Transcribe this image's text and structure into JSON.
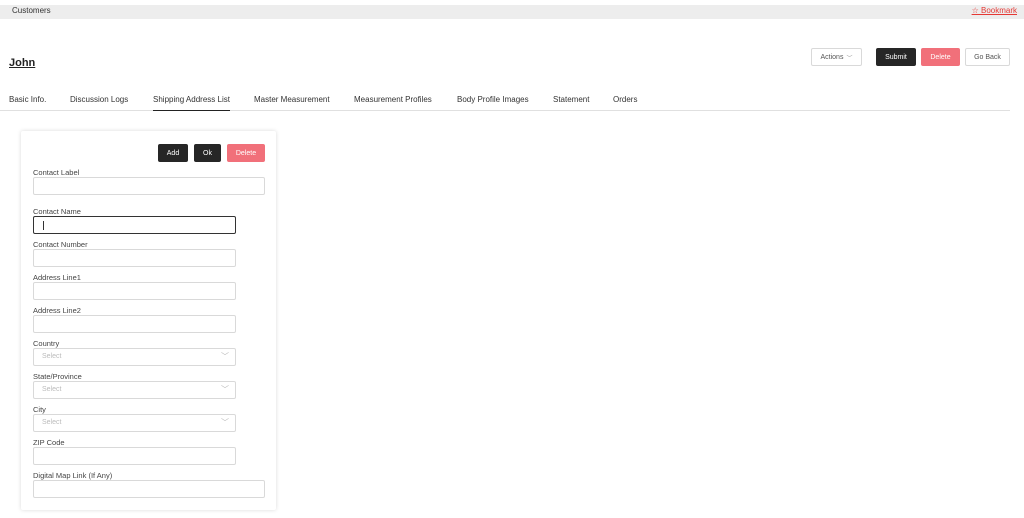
{
  "breadcrumb": {
    "label": "Customers"
  },
  "bookmark": {
    "icon": "star-outline-icon",
    "label": "☆ Bookmark"
  },
  "page": {
    "title": "John"
  },
  "header_actions": {
    "actions_label": "Actions",
    "submit_label": "Submit",
    "delete_label": "Delete",
    "go_back_label": "Go Back"
  },
  "tabs": [
    {
      "label": "Basic Info."
    },
    {
      "label": "Discussion Logs"
    },
    {
      "label": "Shipping Address List",
      "active": true
    },
    {
      "label": "Master Measurement"
    },
    {
      "label": "Measurement Profiles"
    },
    {
      "label": "Body Profile Images"
    },
    {
      "label": "Statement"
    },
    {
      "label": "Orders"
    }
  ],
  "form": {
    "buttons": {
      "add": "Add",
      "ok": "Ok",
      "delete": "Delete"
    },
    "fields": {
      "contact_label": {
        "label": "Contact Label",
        "value": ""
      },
      "contact_name": {
        "label": "Contact Name",
        "value": ""
      },
      "contact_number": {
        "label": "Contact Number",
        "value": ""
      },
      "address_line1": {
        "label": "Address Line1",
        "value": ""
      },
      "address_line2": {
        "label": "Address Line2",
        "value": ""
      },
      "country": {
        "label": "Country",
        "placeholder": "Select"
      },
      "state": {
        "label": "State/Province",
        "placeholder": "Select"
      },
      "city": {
        "label": "City",
        "placeholder": "Select"
      },
      "zip": {
        "label": "ZIP Code",
        "value": ""
      },
      "map_link": {
        "label": "Digital Map Link (If Any)",
        "value": ""
      }
    }
  },
  "colors": {
    "primary_dark": "#262626",
    "danger": "#f1707a",
    "link_red": "#e53935"
  }
}
